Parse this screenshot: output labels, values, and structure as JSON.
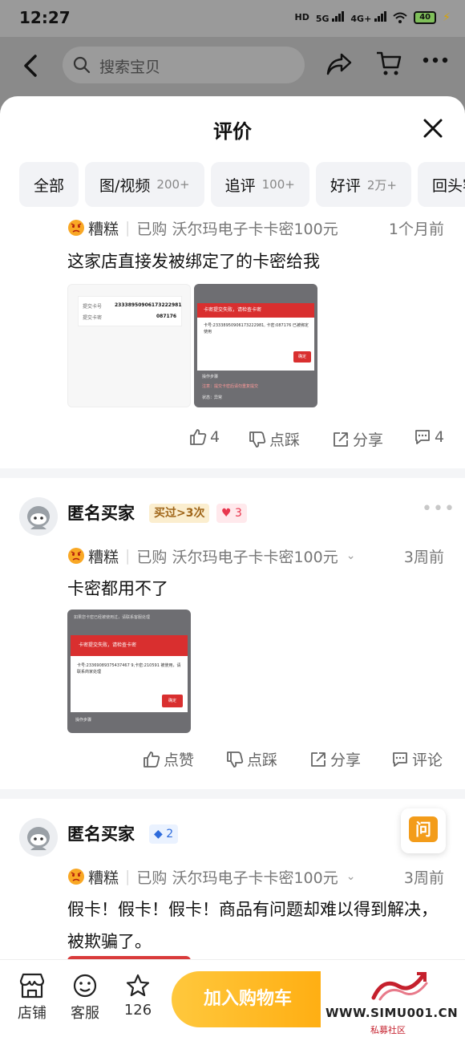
{
  "status": {
    "time": "12:27",
    "net_hd": "HD",
    "net_5g": "5G",
    "net_4g": "4G+",
    "battery": "40"
  },
  "topbar": {
    "search_placeholder": "搜索宝贝"
  },
  "sheet": {
    "title": "评价",
    "filters": [
      {
        "label": "全部",
        "count": ""
      },
      {
        "label": "图/视频",
        "count": "200+"
      },
      {
        "label": "追评",
        "count": "100+"
      },
      {
        "label": "好评",
        "count": "2万+"
      },
      {
        "label": "回头客",
        "count": ""
      }
    ]
  },
  "reviews": [
    {
      "flavor": "糟糕",
      "purchase": "已购 沃尔玛电子卡卡密100元",
      "time": "1个月前",
      "text": "这家店直接发被绑定了的卡密给我",
      "photo1": {
        "line1": "提交卡号",
        "val1": "23338950906173222981",
        "line2": "提交卡密",
        "val2": "087176"
      },
      "photo2": {
        "banner": "卡密提交失败，请检查卡密",
        "body": "卡号:23338950906173222981, 卡密:087176 已被绑定使用",
        "btn": "确定",
        "sec": "操作步骤",
        "note": "注意：提交卡密后请勿重复提交",
        "tail": "状态：异常"
      },
      "actions": {
        "like": "4",
        "dislike": "点踩",
        "share": "分享",
        "comment": "4"
      }
    },
    {
      "user": "匿名买家",
      "badge": "买过>3次",
      "hearts": "3",
      "flavor": "糟糕",
      "purchase": "已购 沃尔玛电子卡卡密100元",
      "time": "3周前",
      "text": "卡密都用不了",
      "photo": {
        "top": "如果您卡密已经被使用过，请联系客服处理",
        "banner": "卡密提交失败，请检查卡密",
        "body": "卡号:23369089375437467 9,卡密:210591 被使用，请联系商家处理",
        "btn": "确定",
        "sec": "操作步骤"
      },
      "actions": {
        "like": "点赞",
        "dislike": "点踩",
        "share": "分享",
        "comment": "评论"
      }
    },
    {
      "user": "匿名买家",
      "level": "2",
      "flavor": "糟糕",
      "purchase": "已购 沃尔玛电子卡卡密100元",
      "time": "3周前",
      "text": "假卡！假卡！假卡！商品有问题却难以得到解决，被欺骗了。"
    }
  ],
  "float": {
    "ask": "问"
  },
  "bottom": {
    "shop": "店铺",
    "service": "客服",
    "fav_count": "126",
    "add_cart": "加入购物车",
    "watermark": "WWW.SIMU001.CN",
    "watermark_sub": "私募社区"
  }
}
